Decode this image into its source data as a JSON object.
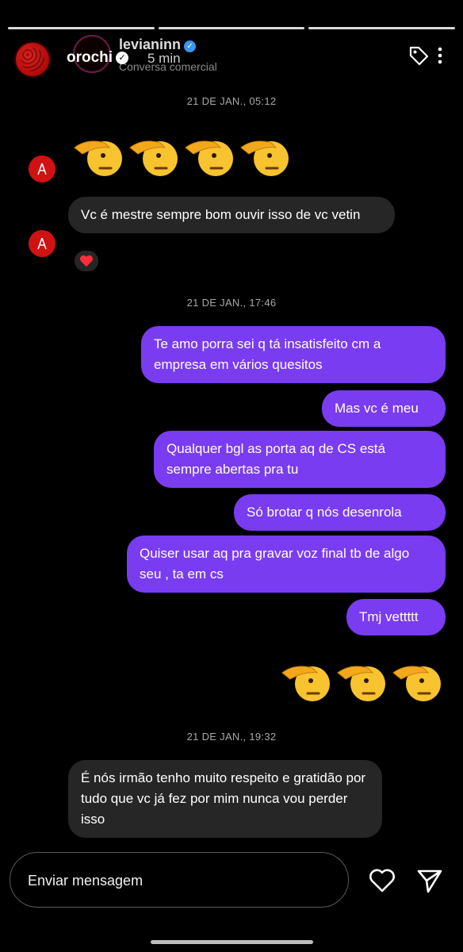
{
  "story": {
    "owner_name": "orochi",
    "time_ago": "5 min"
  },
  "chat_header": {
    "name": "levianinn",
    "subtitle": "Conversa comercial"
  },
  "thread": {
    "timestamps": [
      "21 DE JAN., 05:12",
      "21 DE JAN., 17:46",
      "21 DE JAN., 19:32"
    ],
    "received_1": "Vc é mestre sempre bom ouvir isso de vc vetin",
    "reaction_1": "heart",
    "sent": [
      "Te amo porra sei q tá insatisfeito cm a empresa em vários quesitos",
      "Mas vc é meu",
      "Qualquer bgl as porta aq de CS está sempre abertas pra tu",
      "Só brotar q nós desenrola",
      "Quiser usar aq pra gravar voz final tb de algo seu , ta em cs",
      "Tmj vettttt"
    ],
    "received_2": "É nós irmão tenho muito respeito e gratidão por tudo que vc já fez por mim nunca vou perder isso",
    "emoji_name": "saluting-face"
  },
  "composer": {
    "placeholder": "Enviar mensagem"
  },
  "colors": {
    "sent_bubble": "#7a3cf0",
    "received_bubble": "#262626",
    "background": "#000000"
  }
}
